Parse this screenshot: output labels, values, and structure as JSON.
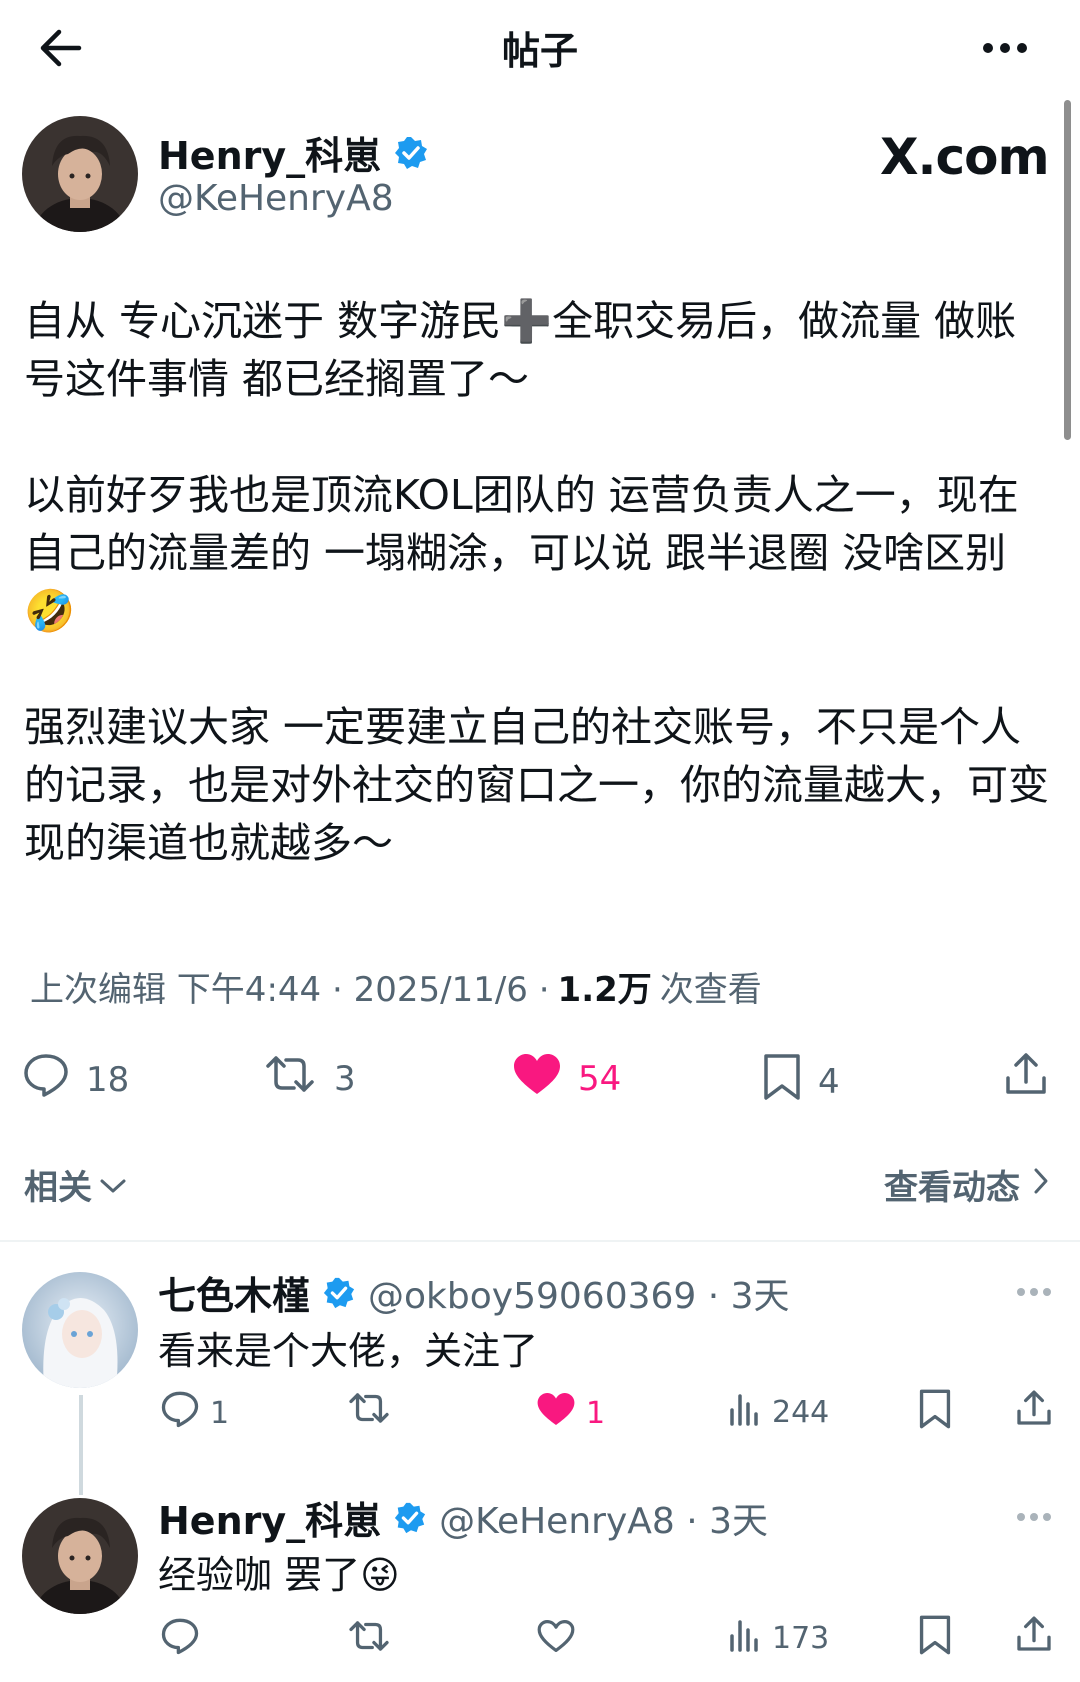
{
  "header": {
    "title": "帖子"
  },
  "post": {
    "author_name": "Henry_科崽",
    "handle": "@KeHenryA8",
    "brand": "X.com",
    "body": [
      "自从 专心沉迷于 数字游民➕全职交易后，做流量 做账号这件事情 都已经搁置了～",
      "以前好歹我也是顶流KOL团队的 运营负责人之一，现在 自己的流量差的 一塌糊涂，可以说 跟半退圈 没啥区别🤣",
      "强烈建议大家 一定要建立自己的社交账号，不只是个人的记录，也是对外社交的窗口之一，你的流量越大，可变现的渠道也就越多～"
    ],
    "meta": {
      "edited": "上次编辑 下午4:44 · 2025/11/6 ·",
      "views_count": "1.2万",
      "views_label": "次查看"
    },
    "actions": {
      "replies": "18",
      "reposts": "3",
      "likes": "54",
      "bookmarks": "4"
    }
  },
  "related_label": "相关",
  "view_activity_label": "查看动态",
  "replies": [
    {
      "name": "七色木槿",
      "handle": "@okboy59060369 · 3天",
      "text": "看来是个大佬，关注了",
      "actions": {
        "replies": "1",
        "likes": "1",
        "views": "244"
      }
    },
    {
      "name": "Henry_科崽",
      "handle": "@KeHenryA8 · 3天",
      "text": "经验咖 罢了😜",
      "actions": {
        "views": "173"
      }
    }
  ],
  "colors": {
    "like": "#f91880",
    "verified": "#1d9bf0",
    "muted": "#536471"
  }
}
